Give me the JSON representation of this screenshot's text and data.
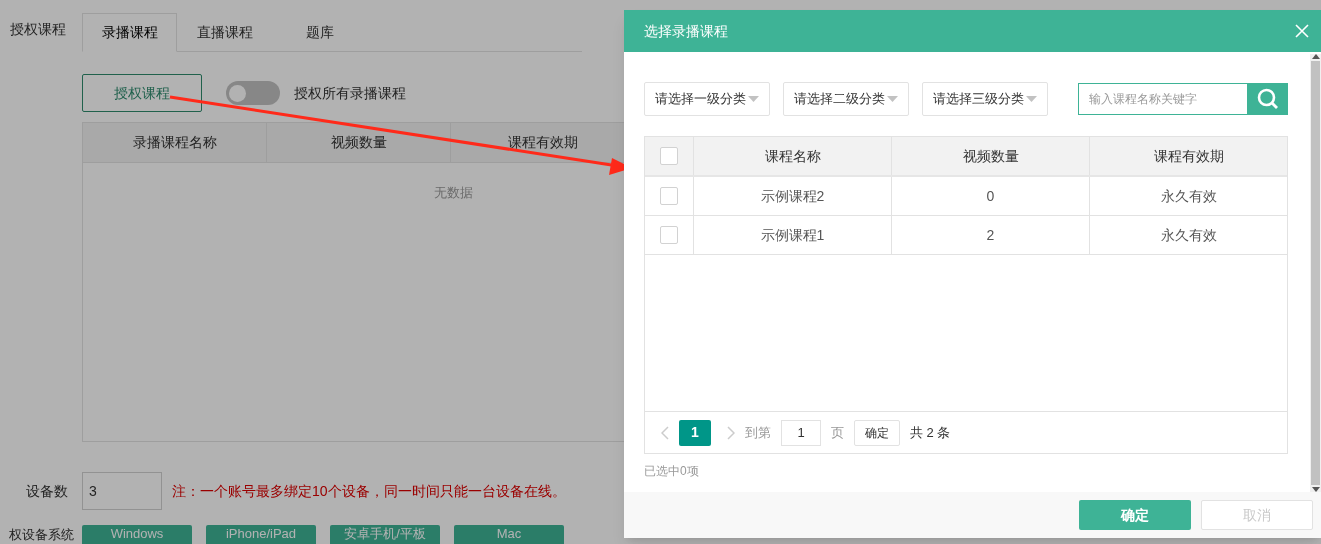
{
  "page": {
    "section_label": "授权课程",
    "tabs": [
      {
        "label": "录播课程",
        "selected": true
      },
      {
        "label": "直播课程",
        "selected": false
      },
      {
        "label": "题库",
        "selected": false
      }
    ],
    "authorize_button": "授权课程",
    "toggle": {
      "label": "授权所有录播课程",
      "on": false
    },
    "table": {
      "columns": [
        "录播课程名称",
        "视频数量",
        "课程有效期"
      ],
      "empty_text": "无数据"
    },
    "device_count": {
      "label": "设备数",
      "value": "3",
      "note": "注：一个账号最多绑定10个设备，同一时间只能一台设备在线。"
    },
    "device_systems": {
      "label": "权设备系统",
      "buttons": [
        "Windows",
        "iPhone/iPad",
        "安卓手机/平板",
        "Mac"
      ]
    }
  },
  "dialog": {
    "title": "选择录播课程",
    "filters": [
      {
        "label": "请选择一级分类"
      },
      {
        "label": "请选择二级分类"
      },
      {
        "label": "请选择三级分类"
      }
    ],
    "search": {
      "placeholder": "输入课程名称关键字"
    },
    "table": {
      "header_checked": false,
      "columns": [
        "课程名称",
        "视频数量",
        "课程有效期"
      ],
      "rows": [
        {
          "checked": false,
          "cells": [
            "示例课程2",
            "0",
            "永久有效"
          ]
        },
        {
          "checked": false,
          "cells": [
            "示例课程1",
            "2",
            "永久有效"
          ]
        }
      ]
    },
    "pagination": {
      "pages": [
        {
          "label": "1",
          "selected": true
        }
      ],
      "goto_label": "到第",
      "page_input": "1",
      "page_unit": "页",
      "confirm": "确定",
      "total": "共 2 条"
    },
    "selected_count": "已选中0项",
    "buttons": [
      {
        "label": "确定",
        "kind": "primary"
      },
      {
        "label": "取消",
        "kind": "disabled"
      }
    ]
  }
}
